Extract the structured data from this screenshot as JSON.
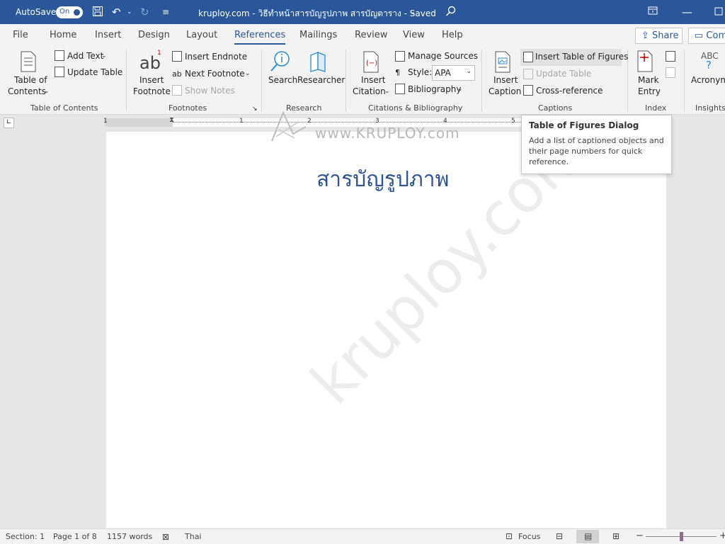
{
  "titlebar": {
    "autosave_label": "AutoSave",
    "autosave_state": "On",
    "doc_title": "kruploy.com - วิธีทำหน้าสารบัญรูปภาพ สารบัญตาราง - Saved",
    "dropdown_glyph": "⌄"
  },
  "menubar": {
    "tabs": [
      "File",
      "Home",
      "Insert",
      "Design",
      "Layout",
      "References",
      "Mailings",
      "Review",
      "View",
      "Help"
    ],
    "active_tab": "References",
    "share_label": "Share",
    "comments_label": "Com"
  },
  "ribbon": {
    "toc": {
      "btn_line1": "Table of",
      "btn_line2": "Contents",
      "add_text": "Add Text",
      "update_table": "Update Table",
      "group_label": "Table of Contents"
    },
    "footnotes": {
      "insert_line1": "Insert",
      "insert_line2": "Footnote",
      "insert_endnote": "Insert Endnote",
      "next_footnote": "Next Footnote",
      "show_notes": "Show Notes",
      "group_label": "Footnotes",
      "footnote_glyph": "ab",
      "footnote_sup": "1"
    },
    "research": {
      "search": "Search",
      "researcher": "Researcher",
      "group_label": "Research"
    },
    "citations": {
      "insert_line1": "Insert",
      "insert_line2": "Citation",
      "manage_sources": "Manage Sources",
      "style_label": "Style:",
      "style_value": "APA",
      "bibliography": "Bibliography",
      "group_label": "Citations & Bibliography"
    },
    "captions": {
      "insert_line1": "Insert",
      "insert_line2": "Caption",
      "insert_tof": "Insert Table of Figures",
      "update_table": "Update Table",
      "cross_reference": "Cross-reference",
      "group_label": "Captions"
    },
    "index": {
      "mark_line1": "Mark",
      "mark_line2": "Entry",
      "group_label": "Index"
    },
    "insights": {
      "abc": "ABC",
      "acronyms": "Acronym",
      "group_label": "Insights"
    }
  },
  "ruler": {
    "numbers": [
      "1",
      "1",
      "2",
      "3",
      "4",
      "5"
    ]
  },
  "document": {
    "heading": "สารบัญรูปภาพ",
    "watermark_top": "www.KRUPLOY.com",
    "watermark_diag": "kruploy.com"
  },
  "tooltip": {
    "title": "Table of Figures Dialog",
    "body": "Add a list of captioned objects and their page numbers for quick reference."
  },
  "statusbar": {
    "section": "Section: 1",
    "page": "Page 1 of 8",
    "words": "1157 words",
    "language": "Thai",
    "focus": "Focus"
  },
  "colors": {
    "brand": "#2b579a",
    "heading": "#2f5496"
  }
}
